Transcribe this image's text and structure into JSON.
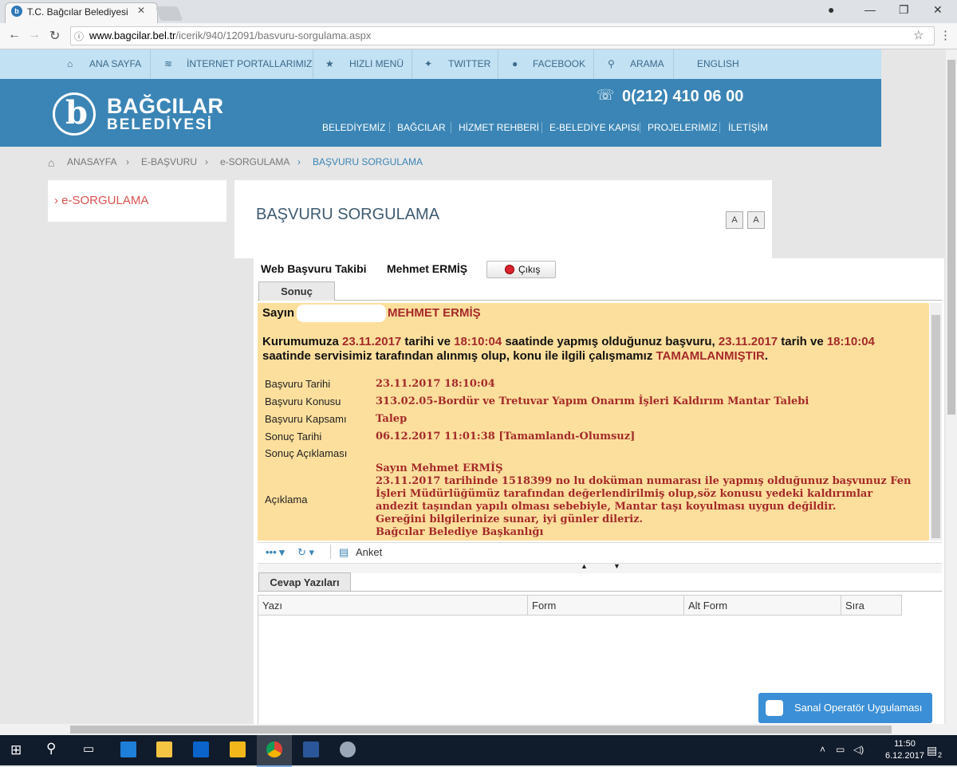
{
  "browser": {
    "tab_title": "T.C. Bağcılar Belediyesi R",
    "url_host": "www.bagcilar.bel.tr",
    "url_path": "/icerik/940/12091/basvuru-sorgulama.aspx"
  },
  "topnav": [
    "ANA SAYFA",
    "İNTERNET PORTALLARIMIZ",
    "HIZLI MENÜ",
    "TWITTER",
    "FACEBOOK",
    "ARAMA",
    "ENGLISH"
  ],
  "header": {
    "logo_line1": "BAĞCILAR",
    "logo_line2": "BELEDİYESİ",
    "phone": "0(212) 410 06 00",
    "mainnav": [
      "BELEDİYEMİZ",
      "BAĞCILAR",
      "HİZMET REHBERİ",
      "E-BELEDİYE KAPISI",
      "PROJELERİMİZ",
      "İLETİŞİM"
    ]
  },
  "breadcrumb": [
    "ANASAYFA",
    "E-BAŞVURU",
    "e-SORGULAMA",
    "BAŞVURU SORGULAMA"
  ],
  "sidebar": {
    "item": "e-SORGULAMA"
  },
  "page": {
    "title": "BAŞVURU SORGULAMA",
    "font_buttons": [
      "A",
      "A"
    ]
  },
  "frame": {
    "heading": "Web Başvuru Takibi",
    "user": "Mehmet ERMİŞ",
    "exit": "Çıkış",
    "tab": "Sonuç"
  },
  "result": {
    "greeting": "Sayın",
    "name": "MEHMET ERMİŞ",
    "msg": {
      "p1": "Kurumumuza ",
      "d1": "23.11.2017",
      "p2": " tarihi ve ",
      "t1": "18:10:04",
      "p3": " saatinde yapmış olduğunuz başvuru, ",
      "d2": "23.11.2017",
      "p4": " tarih ve ",
      "t2": "18:10:04",
      "p5": " saatinde servisimiz tarafından alınmış olup, konu ile ilgili çalışmamız ",
      "status": "TAMAMLANMIŞTIR",
      "p6": "."
    },
    "rows": [
      {
        "label": "Başvuru Tarihi",
        "value": "23.11.2017 18:10:04"
      },
      {
        "label": "Başvuru Konusu",
        "value": "313.02.05-Bordür ve Tretuvar Yapım Onarım İşleri Kaldırım Mantar Talebi"
      },
      {
        "label": "Başvuru Kapsamı",
        "value": "Talep"
      },
      {
        "label": "Sonuç Tarihi",
        "value": "06.12.2017 11:01:38 [Tamamlandı-Olumsuz]"
      },
      {
        "label": "Sonuç Açıklaması",
        "value": ""
      }
    ],
    "aciklama_label": "Açıklama",
    "aciklama": "Sayın Mehmet ERMİŞ\n23.11.2017 tarihinde 1518399 no lu doküman numarası ile yapmış olduğunuz başvunuz Fen İşleri Müdürlüğümüz tarafından değerlendirilmiş olup,söz konusu yedeki kaldırımlar andezit taşından yapılı olması sebebiyle, Mantar taşı koyulması uygun değildir.\nGereğini bilgilerinize sunar, iyi günler dileriz.\nBağcılar Belediye Başkanlığı"
  },
  "toolbar": {
    "anket": "Anket"
  },
  "cevap": {
    "tab": "Cevap Yazıları",
    "columns": [
      "Yazı",
      "Form",
      "Alt Form",
      "Sıra"
    ]
  },
  "operator": "Sanal Operatör Uygulaması",
  "taskbar": {
    "time": "11:50",
    "date": "6.12.2017",
    "notif": "2"
  },
  "colors": {
    "header": "#3a85b5",
    "topnav": "#c2e1f3",
    "result_bg": "#fddf9d",
    "accent_red": "#a52a2a"
  }
}
